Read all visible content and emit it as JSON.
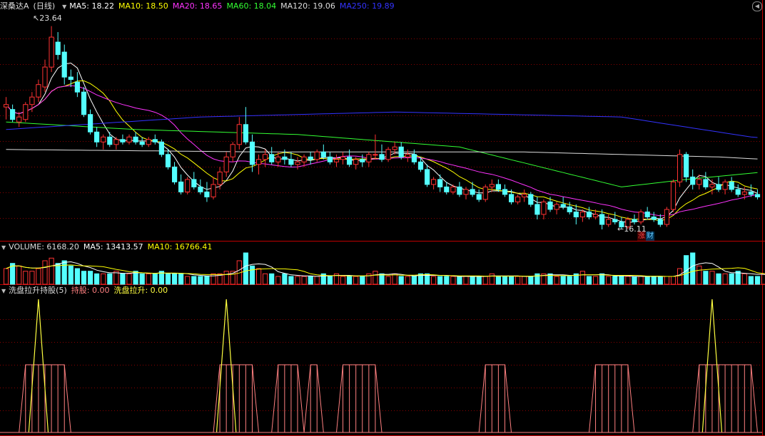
{
  "header": {
    "stock": "深桑达A",
    "period": "(日线)",
    "ma5": "MA5: 18.22",
    "ma10": "MA10: 18.50",
    "ma20": "MA20: 18.65",
    "ma60": "MA60: 18.04",
    "ma120": "MA120: 19.06",
    "ma250": "MA250: 19.89"
  },
  "volume_header": {
    "title": "VOLUME: 6168.20",
    "ma5": "MA5: 13413.57",
    "ma10": "MA10: 16766.41"
  },
  "indicator_header": {
    "title": "洗盘拉升持股(5)",
    "hold": "持股: 0.00",
    "pull": "洗盘拉升: 0.00"
  },
  "markers": {
    "high": "23.64",
    "low": "16.11",
    "badge_up": "涨",
    "badge_fin": "财"
  },
  "colors": {
    "up": "#ff3232",
    "down": "#54ffff",
    "ma5": "#ffffff",
    "ma10": "#ffff00",
    "ma20": "#ff33ff",
    "ma60": "#33ff33",
    "ma120": "#dddddd",
    "ma250": "#3333ff",
    "grid": "#8a0000",
    "pane_border": "#c00000",
    "hold": "#ff8080",
    "pull": "#ffff40"
  },
  "chart_data": [
    {
      "type": "candlestick",
      "title": "深桑达A (日线)",
      "ylim": [
        15.5,
        24.2
      ],
      "candles": [
        {
          "o": 20.4,
          "h": 20.8,
          "l": 19.9,
          "c": 20.5
        },
        {
          "o": 20.3,
          "h": 20.5,
          "l": 19.8,
          "c": 19.9
        },
        {
          "o": 19.8,
          "h": 20.2,
          "l": 19.6,
          "c": 20.0
        },
        {
          "o": 19.9,
          "h": 20.6,
          "l": 19.8,
          "c": 20.5
        },
        {
          "o": 20.5,
          "h": 21.0,
          "l": 20.2,
          "c": 20.8
        },
        {
          "o": 20.8,
          "h": 21.5,
          "l": 20.6,
          "c": 21.3
        },
        {
          "o": 21.2,
          "h": 22.3,
          "l": 21.0,
          "c": 22.0
        },
        {
          "o": 22.0,
          "h": 23.64,
          "l": 21.8,
          "c": 23.2
        },
        {
          "o": 23.0,
          "h": 23.4,
          "l": 22.3,
          "c": 22.5
        },
        {
          "o": 22.6,
          "h": 22.9,
          "l": 21.3,
          "c": 21.6
        },
        {
          "o": 21.6,
          "h": 21.9,
          "l": 21.2,
          "c": 21.5
        },
        {
          "o": 21.4,
          "h": 21.8,
          "l": 20.8,
          "c": 21.0
        },
        {
          "o": 21.0,
          "h": 21.2,
          "l": 20.0,
          "c": 20.1
        },
        {
          "o": 20.1,
          "h": 20.3,
          "l": 19.3,
          "c": 19.4
        },
        {
          "o": 19.4,
          "h": 19.6,
          "l": 18.8,
          "c": 19.0
        },
        {
          "o": 19.0,
          "h": 19.3,
          "l": 18.7,
          "c": 19.2
        },
        {
          "o": 19.2,
          "h": 19.4,
          "l": 18.8,
          "c": 18.9
        },
        {
          "o": 18.9,
          "h": 19.2,
          "l": 18.7,
          "c": 19.1
        },
        {
          "o": 19.1,
          "h": 19.3,
          "l": 18.9,
          "c": 19.0
        },
        {
          "o": 19.0,
          "h": 19.3,
          "l": 18.9,
          "c": 19.2
        },
        {
          "o": 19.2,
          "h": 19.4,
          "l": 18.9,
          "c": 19.0
        },
        {
          "o": 19.0,
          "h": 19.2,
          "l": 18.8,
          "c": 18.9
        },
        {
          "o": 18.9,
          "h": 19.2,
          "l": 18.8,
          "c": 19.1
        },
        {
          "o": 19.1,
          "h": 19.3,
          "l": 18.9,
          "c": 19.0
        },
        {
          "o": 19.0,
          "h": 19.1,
          "l": 18.4,
          "c": 18.5
        },
        {
          "o": 18.5,
          "h": 18.7,
          "l": 17.9,
          "c": 18.0
        },
        {
          "o": 18.0,
          "h": 18.2,
          "l": 17.3,
          "c": 17.4
        },
        {
          "o": 17.4,
          "h": 17.7,
          "l": 16.9,
          "c": 17.0
        },
        {
          "o": 17.0,
          "h": 17.6,
          "l": 16.9,
          "c": 17.5
        },
        {
          "o": 17.5,
          "h": 17.8,
          "l": 17.1,
          "c": 17.2
        },
        {
          "o": 17.2,
          "h": 17.5,
          "l": 16.9,
          "c": 17.0
        },
        {
          "o": 17.0,
          "h": 17.4,
          "l": 16.6,
          "c": 16.8
        },
        {
          "o": 16.8,
          "h": 17.6,
          "l": 16.7,
          "c": 17.3
        },
        {
          "o": 17.3,
          "h": 18.0,
          "l": 17.1,
          "c": 17.8
        },
        {
          "o": 17.8,
          "h": 18.6,
          "l": 17.6,
          "c": 18.4
        },
        {
          "o": 18.4,
          "h": 19.0,
          "l": 18.2,
          "c": 18.9
        },
        {
          "o": 18.9,
          "h": 20.0,
          "l": 18.7,
          "c": 19.7
        },
        {
          "o": 19.7,
          "h": 20.4,
          "l": 18.9,
          "c": 19.0
        },
        {
          "o": 19.0,
          "h": 19.3,
          "l": 17.8,
          "c": 18.1
        },
        {
          "o": 18.1,
          "h": 18.5,
          "l": 17.7,
          "c": 18.3
        },
        {
          "o": 18.3,
          "h": 18.7,
          "l": 18.0,
          "c": 18.5
        },
        {
          "o": 18.5,
          "h": 18.8,
          "l": 18.1,
          "c": 18.2
        },
        {
          "o": 18.2,
          "h": 18.6,
          "l": 18.0,
          "c": 18.4
        },
        {
          "o": 18.4,
          "h": 18.7,
          "l": 18.1,
          "c": 18.3
        },
        {
          "o": 18.3,
          "h": 18.6,
          "l": 18.0,
          "c": 18.1
        },
        {
          "o": 18.1,
          "h": 18.4,
          "l": 17.9,
          "c": 18.2
        },
        {
          "o": 18.2,
          "h": 18.5,
          "l": 18.0,
          "c": 18.4
        },
        {
          "o": 18.4,
          "h": 18.6,
          "l": 18.1,
          "c": 18.3
        },
        {
          "o": 18.3,
          "h": 18.7,
          "l": 18.2,
          "c": 18.6
        },
        {
          "o": 18.6,
          "h": 18.9,
          "l": 18.3,
          "c": 18.4
        },
        {
          "o": 18.4,
          "h": 18.6,
          "l": 18.1,
          "c": 18.2
        },
        {
          "o": 18.2,
          "h": 18.5,
          "l": 18.0,
          "c": 18.3
        },
        {
          "o": 18.3,
          "h": 18.6,
          "l": 18.1,
          "c": 18.4
        },
        {
          "o": 18.4,
          "h": 18.7,
          "l": 18.0,
          "c": 18.1
        },
        {
          "o": 18.1,
          "h": 18.4,
          "l": 17.9,
          "c": 18.3
        },
        {
          "o": 18.3,
          "h": 18.5,
          "l": 18.0,
          "c": 18.2
        },
        {
          "o": 18.2,
          "h": 18.6,
          "l": 18.0,
          "c": 18.5
        },
        {
          "o": 18.5,
          "h": 19.3,
          "l": 18.3,
          "c": 18.5
        },
        {
          "o": 18.5,
          "h": 18.9,
          "l": 18.2,
          "c": 18.3
        },
        {
          "o": 18.3,
          "h": 18.8,
          "l": 18.2,
          "c": 18.7
        },
        {
          "o": 18.7,
          "h": 19.0,
          "l": 18.5,
          "c": 18.8
        },
        {
          "o": 18.8,
          "h": 19.0,
          "l": 18.3,
          "c": 18.4
        },
        {
          "o": 18.4,
          "h": 18.7,
          "l": 18.2,
          "c": 18.5
        },
        {
          "o": 18.5,
          "h": 18.7,
          "l": 18.1,
          "c": 18.2
        },
        {
          "o": 18.2,
          "h": 18.4,
          "l": 17.8,
          "c": 17.9
        },
        {
          "o": 17.9,
          "h": 18.1,
          "l": 17.2,
          "c": 17.3
        },
        {
          "o": 17.3,
          "h": 17.6,
          "l": 17.1,
          "c": 17.5
        },
        {
          "o": 17.5,
          "h": 17.7,
          "l": 17.0,
          "c": 17.2
        },
        {
          "o": 17.2,
          "h": 17.4,
          "l": 16.9,
          "c": 17.0
        },
        {
          "o": 17.0,
          "h": 17.3,
          "l": 16.9,
          "c": 17.2
        },
        {
          "o": 17.2,
          "h": 17.4,
          "l": 16.8,
          "c": 16.9
        },
        {
          "o": 16.9,
          "h": 17.2,
          "l": 16.7,
          "c": 17.1
        },
        {
          "o": 17.1,
          "h": 17.4,
          "l": 16.8,
          "c": 16.9
        },
        {
          "o": 16.9,
          "h": 17.1,
          "l": 16.6,
          "c": 16.7
        },
        {
          "o": 16.7,
          "h": 17.3,
          "l": 16.6,
          "c": 17.2
        },
        {
          "o": 17.2,
          "h": 17.5,
          "l": 17.0,
          "c": 17.3
        },
        {
          "o": 17.3,
          "h": 17.5,
          "l": 17.0,
          "c": 17.1
        },
        {
          "o": 17.1,
          "h": 17.3,
          "l": 16.8,
          "c": 16.9
        },
        {
          "o": 16.9,
          "h": 17.1,
          "l": 16.5,
          "c": 16.6
        },
        {
          "o": 16.6,
          "h": 16.9,
          "l": 16.5,
          "c": 16.8
        },
        {
          "o": 16.8,
          "h": 17.1,
          "l": 16.6,
          "c": 16.9
        },
        {
          "o": 16.9,
          "h": 17.0,
          "l": 16.4,
          "c": 16.5
        },
        {
          "o": 16.5,
          "h": 16.8,
          "l": 15.9,
          "c": 16.1
        },
        {
          "o": 16.1,
          "h": 16.7,
          "l": 15.9,
          "c": 16.6
        },
        {
          "o": 16.6,
          "h": 16.8,
          "l": 16.2,
          "c": 16.3
        },
        {
          "o": 16.3,
          "h": 16.6,
          "l": 16.1,
          "c": 16.5
        },
        {
          "o": 16.5,
          "h": 16.8,
          "l": 16.3,
          "c": 16.4
        },
        {
          "o": 16.4,
          "h": 16.6,
          "l": 16.1,
          "c": 16.2
        },
        {
          "o": 16.2,
          "h": 16.5,
          "l": 15.7,
          "c": 16.0
        },
        {
          "o": 16.0,
          "h": 16.3,
          "l": 15.8,
          "c": 16.2
        },
        {
          "o": 16.2,
          "h": 16.4,
          "l": 15.9,
          "c": 16.0
        },
        {
          "o": 16.0,
          "h": 16.3,
          "l": 15.9,
          "c": 16.1
        },
        {
          "o": 16.1,
          "h": 16.3,
          "l": 15.5,
          "c": 15.7
        },
        {
          "o": 15.7,
          "h": 16.1,
          "l": 15.6,
          "c": 15.9
        },
        {
          "o": 15.9,
          "h": 16.2,
          "l": 15.7,
          "c": 15.8
        },
        {
          "o": 15.8,
          "h": 16.0,
          "l": 15.5,
          "c": 15.6
        },
        {
          "o": 15.6,
          "h": 16.0,
          "l": 15.5,
          "c": 15.9
        },
        {
          "o": 15.9,
          "h": 16.1,
          "l": 15.7,
          "c": 15.8
        },
        {
          "o": 15.8,
          "h": 16.3,
          "l": 15.7,
          "c": 16.2
        },
        {
          "o": 16.2,
          "h": 16.4,
          "l": 15.9,
          "c": 16.0
        },
        {
          "o": 16.0,
          "h": 16.2,
          "l": 15.8,
          "c": 15.9
        },
        {
          "o": 15.9,
          "h": 16.11,
          "l": 15.6,
          "c": 15.7
        },
        {
          "o": 15.7,
          "h": 16.4,
          "l": 15.6,
          "c": 16.3
        },
        {
          "o": 16.3,
          "h": 17.5,
          "l": 16.2,
          "c": 17.4
        },
        {
          "o": 17.4,
          "h": 18.7,
          "l": 17.2,
          "c": 18.5
        },
        {
          "o": 18.5,
          "h": 18.6,
          "l": 17.4,
          "c": 17.6
        },
        {
          "o": 17.6,
          "h": 17.9,
          "l": 17.1,
          "c": 17.3
        },
        {
          "o": 17.3,
          "h": 17.7,
          "l": 17.1,
          "c": 17.5
        },
        {
          "o": 17.5,
          "h": 17.8,
          "l": 17.1,
          "c": 17.2
        },
        {
          "o": 17.2,
          "h": 17.5,
          "l": 16.9,
          "c": 17.3
        },
        {
          "o": 17.3,
          "h": 17.6,
          "l": 17.0,
          "c": 17.1
        },
        {
          "o": 17.1,
          "h": 17.5,
          "l": 16.9,
          "c": 17.4
        },
        {
          "o": 17.4,
          "h": 17.6,
          "l": 17.0,
          "c": 17.1
        },
        {
          "o": 17.1,
          "h": 17.3,
          "l": 16.8,
          "c": 16.9
        },
        {
          "o": 16.9,
          "h": 17.2,
          "l": 16.7,
          "c": 17.0
        },
        {
          "o": 17.0,
          "h": 17.3,
          "l": 16.8,
          "c": 16.9
        },
        {
          "o": 16.9,
          "h": 17.1,
          "l": 16.7,
          "c": 16.8
        }
      ],
      "ma_series": [
        {
          "name": "MA5",
          "period": 5,
          "color_key": "ma5"
        },
        {
          "name": "MA10",
          "period": 10,
          "color_key": "ma10"
        },
        {
          "name": "MA20",
          "period": 20,
          "color_key": "ma20"
        },
        {
          "name": "MA60",
          "values_anchor": [
            [
              0,
              19.8
            ],
            [
              20,
              19.5
            ],
            [
              45,
              19.3
            ],
            [
              70,
              18.8
            ],
            [
              95,
              17.2
            ],
            [
              105,
              17.5
            ],
            [
              125,
              18.0
            ]
          ],
          "color_key": "ma60"
        },
        {
          "name": "MA120",
          "values_anchor": [
            [
              0,
              18.7
            ],
            [
              40,
              18.6
            ],
            [
              80,
              18.6
            ],
            [
              110,
              18.4
            ],
            [
              125,
              18.2
            ]
          ],
          "color_key": "ma120"
        },
        {
          "name": "MA250",
          "values_anchor": [
            [
              0,
              19.5
            ],
            [
              30,
              20.0
            ],
            [
              60,
              20.2
            ],
            [
              95,
              20.0
            ],
            [
              115,
              19.2
            ],
            [
              125,
              19.0
            ]
          ],
          "color_key": "ma250"
        }
      ]
    },
    {
      "type": "bar",
      "title": "VOLUME",
      "ylim": [
        0,
        100000
      ],
      "values": [
        6,
        8,
        7,
        5,
        5,
        6,
        9,
        10,
        8,
        9,
        7,
        6,
        5,
        5,
        4,
        4,
        4,
        5,
        4,
        4,
        5,
        4,
        4,
        4,
        5,
        4,
        4,
        4,
        3,
        3,
        3,
        3,
        4,
        4,
        5,
        5,
        9,
        12,
        7,
        6,
        4,
        4,
        3,
        4,
        3,
        3,
        3,
        3,
        3,
        4,
        3,
        4,
        3,
        3,
        3,
        3,
        4,
        5,
        4,
        3,
        4,
        3,
        3,
        3,
        4,
        4,
        3,
        3,
        3,
        3,
        3,
        3,
        3,
        3,
        3,
        4,
        3,
        3,
        3,
        3,
        3,
        3,
        4,
        4,
        4,
        3,
        3,
        3,
        4,
        5,
        3,
        3,
        4,
        3,
        3,
        3,
        3,
        3,
        3,
        3,
        3,
        3,
        3,
        3,
        6,
        11,
        12,
        7,
        5,
        5,
        4,
        4,
        4,
        5,
        4,
        3,
        3,
        4,
        3,
        3,
        4,
        3,
        3,
        3,
        2,
        2
      ]
    },
    {
      "type": "line",
      "title": "洗盘拉升持股(5)",
      "series": [
        {
          "name": "持股",
          "color_key": "hold"
        },
        {
          "name": "洗盘拉升",
          "color_key": "pull"
        }
      ],
      "hold_ranges": [
        [
          3,
          9
        ],
        [
          33,
          38
        ],
        [
          42,
          45
        ],
        [
          47,
          48
        ],
        [
          52,
          57
        ],
        [
          74,
          77
        ],
        [
          91,
          96
        ],
        [
          107,
          115
        ],
        [
          123,
          127
        ]
      ],
      "pull_spikes": [
        5,
        34,
        109
      ]
    }
  ]
}
